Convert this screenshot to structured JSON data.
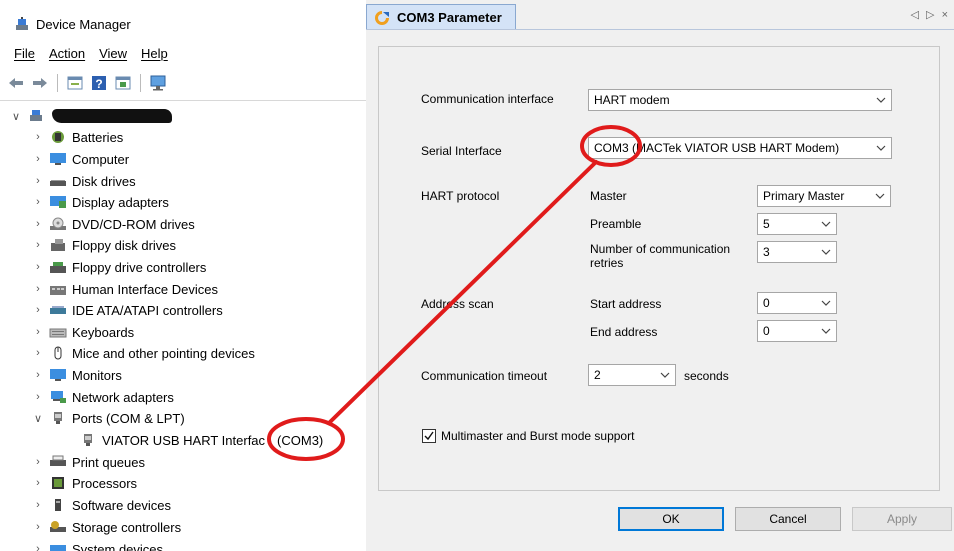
{
  "device_manager": {
    "title": "Device Manager",
    "menu": [
      "File",
      "Action",
      "View",
      "Help"
    ],
    "toolbar_icons": [
      "back-icon",
      "forward-icon",
      "properties-icon",
      "help-icon",
      "update-driver-icon",
      "scan-hardware-icon"
    ],
    "tree": [
      {
        "label": "",
        "icon": "computer-root-icon",
        "caret": "∨"
      },
      {
        "label": "Batteries",
        "icon": "battery-icon",
        "caret": "›"
      },
      {
        "label": "Computer",
        "icon": "monitor-icon",
        "caret": "›"
      },
      {
        "label": "Disk drives",
        "icon": "disk-drive-icon",
        "caret": "›"
      },
      {
        "label": "Display adapters",
        "icon": "display-adapter-icon",
        "caret": "›"
      },
      {
        "label": "DVD/CD-ROM drives",
        "icon": "dvd-icon",
        "caret": "›"
      },
      {
        "label": "Floppy disk drives",
        "icon": "floppy-icon",
        "caret": "›"
      },
      {
        "label": "Floppy drive controllers",
        "icon": "floppy-controller-icon",
        "caret": "›"
      },
      {
        "label": "Human Interface Devices",
        "icon": "hid-icon",
        "caret": "›"
      },
      {
        "label": "IDE ATA/ATAPI controllers",
        "icon": "ide-icon",
        "caret": "›"
      },
      {
        "label": "Keyboards",
        "icon": "keyboard-icon",
        "caret": "›"
      },
      {
        "label": "Mice and other pointing devices",
        "icon": "mouse-icon",
        "caret": "›"
      },
      {
        "label": "Monitors",
        "icon": "monitor-icon",
        "caret": "›"
      },
      {
        "label": "Network adapters",
        "icon": "network-icon",
        "caret": "›"
      },
      {
        "label": "Ports (COM & LPT)",
        "icon": "port-icon",
        "caret": "∨"
      },
      {
        "label": "VIATOR USB HART Interfac",
        "icon": "port-device-icon",
        "caret": "",
        "suffix": "(COM3)"
      },
      {
        "label": "Print queues",
        "icon": "printer-icon",
        "caret": "›"
      },
      {
        "label": "Processors",
        "icon": "processor-icon",
        "caret": "›"
      },
      {
        "label": "Software devices",
        "icon": "software-device-icon",
        "caret": "›"
      },
      {
        "label": "Storage controllers",
        "icon": "storage-icon",
        "caret": "›"
      },
      {
        "label": "System devices",
        "icon": "system-icon",
        "caret": "›"
      }
    ]
  },
  "com_panel": {
    "tab_title": "COM3 Parameter",
    "tab_nav": "◁ ▷ ×",
    "labels": {
      "comm_interface": "Communication interface",
      "serial_interface": "Serial Interface",
      "hart_protocol": "HART protocol",
      "master": "Master",
      "preamble": "Preamble",
      "retries": "Number of communication retries",
      "address_scan": "Address scan",
      "start_address": "Start address",
      "end_address": "End address",
      "comm_timeout": "Communication timeout",
      "seconds": "seconds",
      "multimaster": "Multimaster and Burst mode support"
    },
    "values": {
      "comm_interface": "HART modem",
      "serial_interface": "COM3 (MACTek VIATOR USB HART Modem)",
      "master": "Primary Master",
      "preamble": "5",
      "retries": "3",
      "start_address": "0",
      "end_address": "0",
      "comm_timeout": "2",
      "multimaster_checked": true
    },
    "buttons": {
      "ok": "OK",
      "cancel": "Cancel",
      "apply": "Apply"
    }
  },
  "annotation": {
    "color": "#e01b1b"
  }
}
